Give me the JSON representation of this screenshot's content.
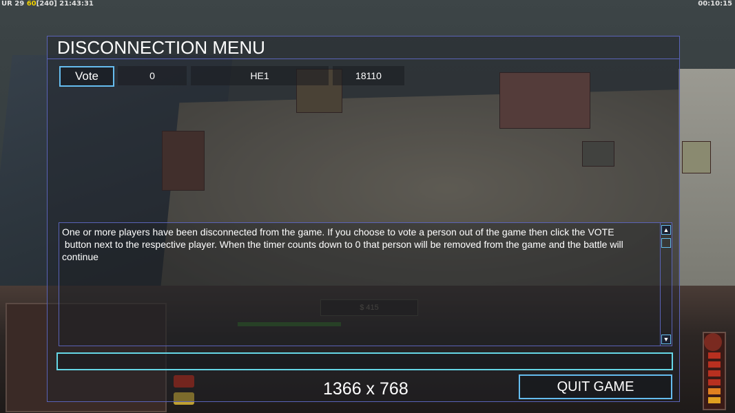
{
  "overlay": {
    "top_left_prefix": "UR 29",
    "top_left_fps": "60",
    "top_left_rest": "[240] 21:43:31",
    "top_right": "00:10:15"
  },
  "hud": {
    "money": "$ 415"
  },
  "dialog": {
    "title": "DISCONNECTION MENU",
    "player_row": {
      "vote_label": "Vote",
      "slot": "0",
      "player_name": "HE1",
      "ping": "18110"
    },
    "message_lines": [
      "One or more players have been disconnected from the game. If you choose to vote a person out of the game then click the VOTE",
      " button next to the respective player. When the timer counts down to 0 that person will be removed from the game and the battle will",
      "continue"
    ],
    "scroll_up_icon": "scroll-up-arrow",
    "scroll_down_icon": "scroll-down-arrow",
    "resolution": "1366 x 768",
    "quit_label": "QUIT GAME"
  },
  "colors": {
    "frame": "#5a63b8",
    "button_border": "#66bdf0",
    "input_border": "#66d8e8",
    "fps_highlight": "#f0d000"
  }
}
